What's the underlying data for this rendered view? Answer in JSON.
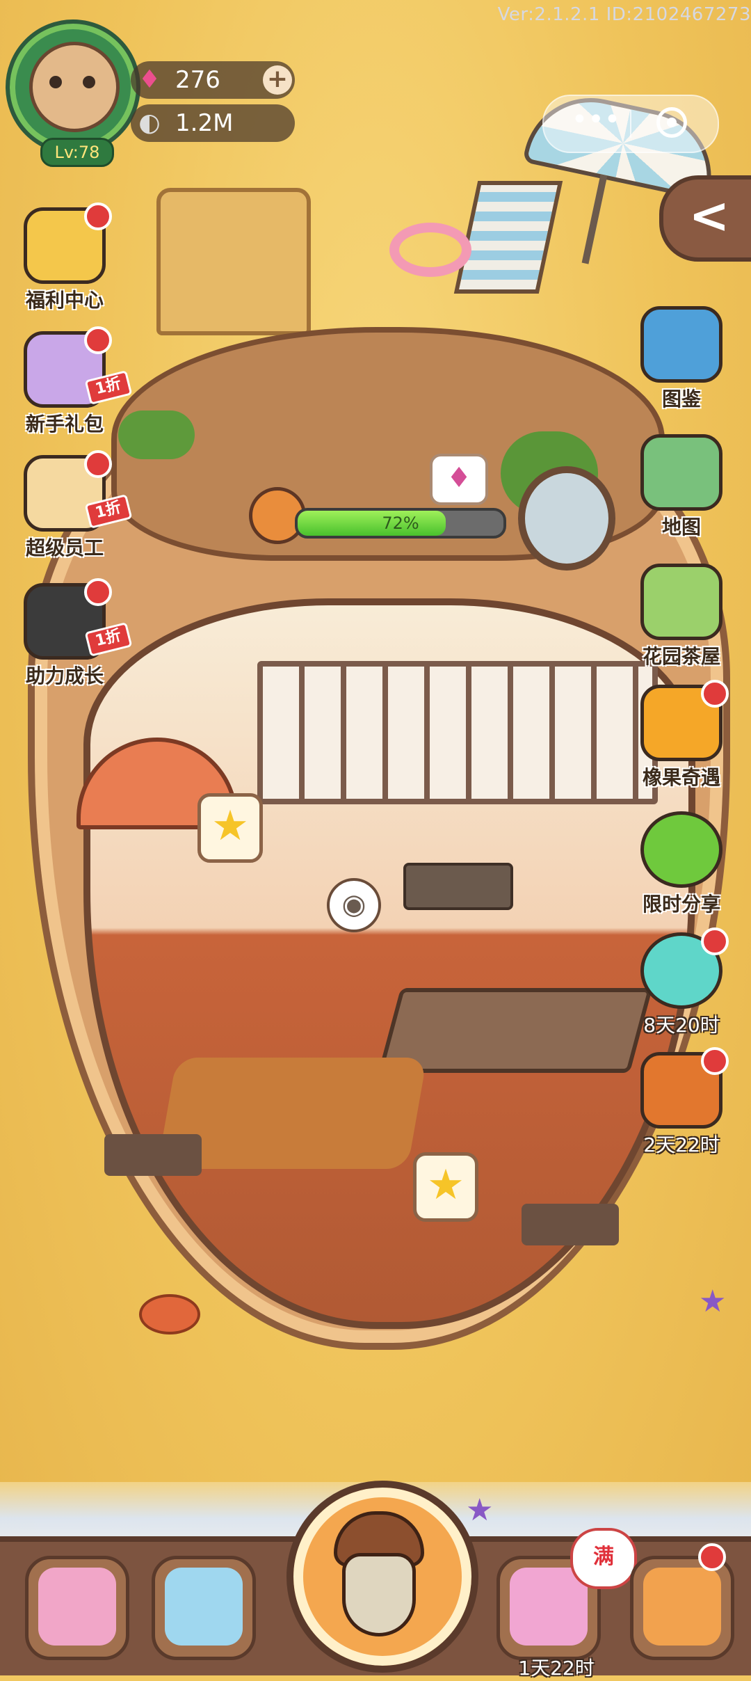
{
  "version_text": "Ver:2.1.2.1 ID:2102467273",
  "player": {
    "level": "Lv:78",
    "gems": "276",
    "gems_plus": "+",
    "seeds": "1.2M",
    "gem_icon": "gem-icon",
    "seed_icon": "sunflower-seed-icon"
  },
  "capsule": {
    "more": "•••",
    "close_icon": "target-close-icon"
  },
  "collapse_label": "<",
  "left_menu": [
    {
      "label": "福利中心",
      "badge": "",
      "color": "#f4c74b"
    },
    {
      "label": "新手礼包",
      "badge": "1折",
      "color": "#c9a7e8"
    },
    {
      "label": "超级员工",
      "badge": "1折",
      "color": "#f5d9a0"
    },
    {
      "label": "助力成长",
      "badge": "1折",
      "color": "#3b3b3b"
    }
  ],
  "right_menu": [
    {
      "label": "图鉴",
      "color": "#4fa0d9"
    },
    {
      "label": "地图",
      "color": "#79c17c"
    },
    {
      "label": "花园茶屋",
      "color": "#9bd06b"
    },
    {
      "label": "橡果奇遇",
      "color": "#f5a728"
    },
    {
      "label": "限时分享",
      "color": "#6fc93d"
    },
    {
      "label": "8天20时",
      "color": "#5fd6c9"
    },
    {
      "label": "2天22时",
      "color": "#e2772e"
    }
  ],
  "progress": {
    "percent_label": "72%",
    "value": 0.72,
    "gem_reward_icon": "pink-gem-icon"
  },
  "bottom_bar": {
    "tree_timer": "1天22时",
    "full_badge": "满"
  },
  "colors": {
    "sand": "#efc35a",
    "bar": "#7d5440",
    "red_dot": "#e03b3b"
  }
}
